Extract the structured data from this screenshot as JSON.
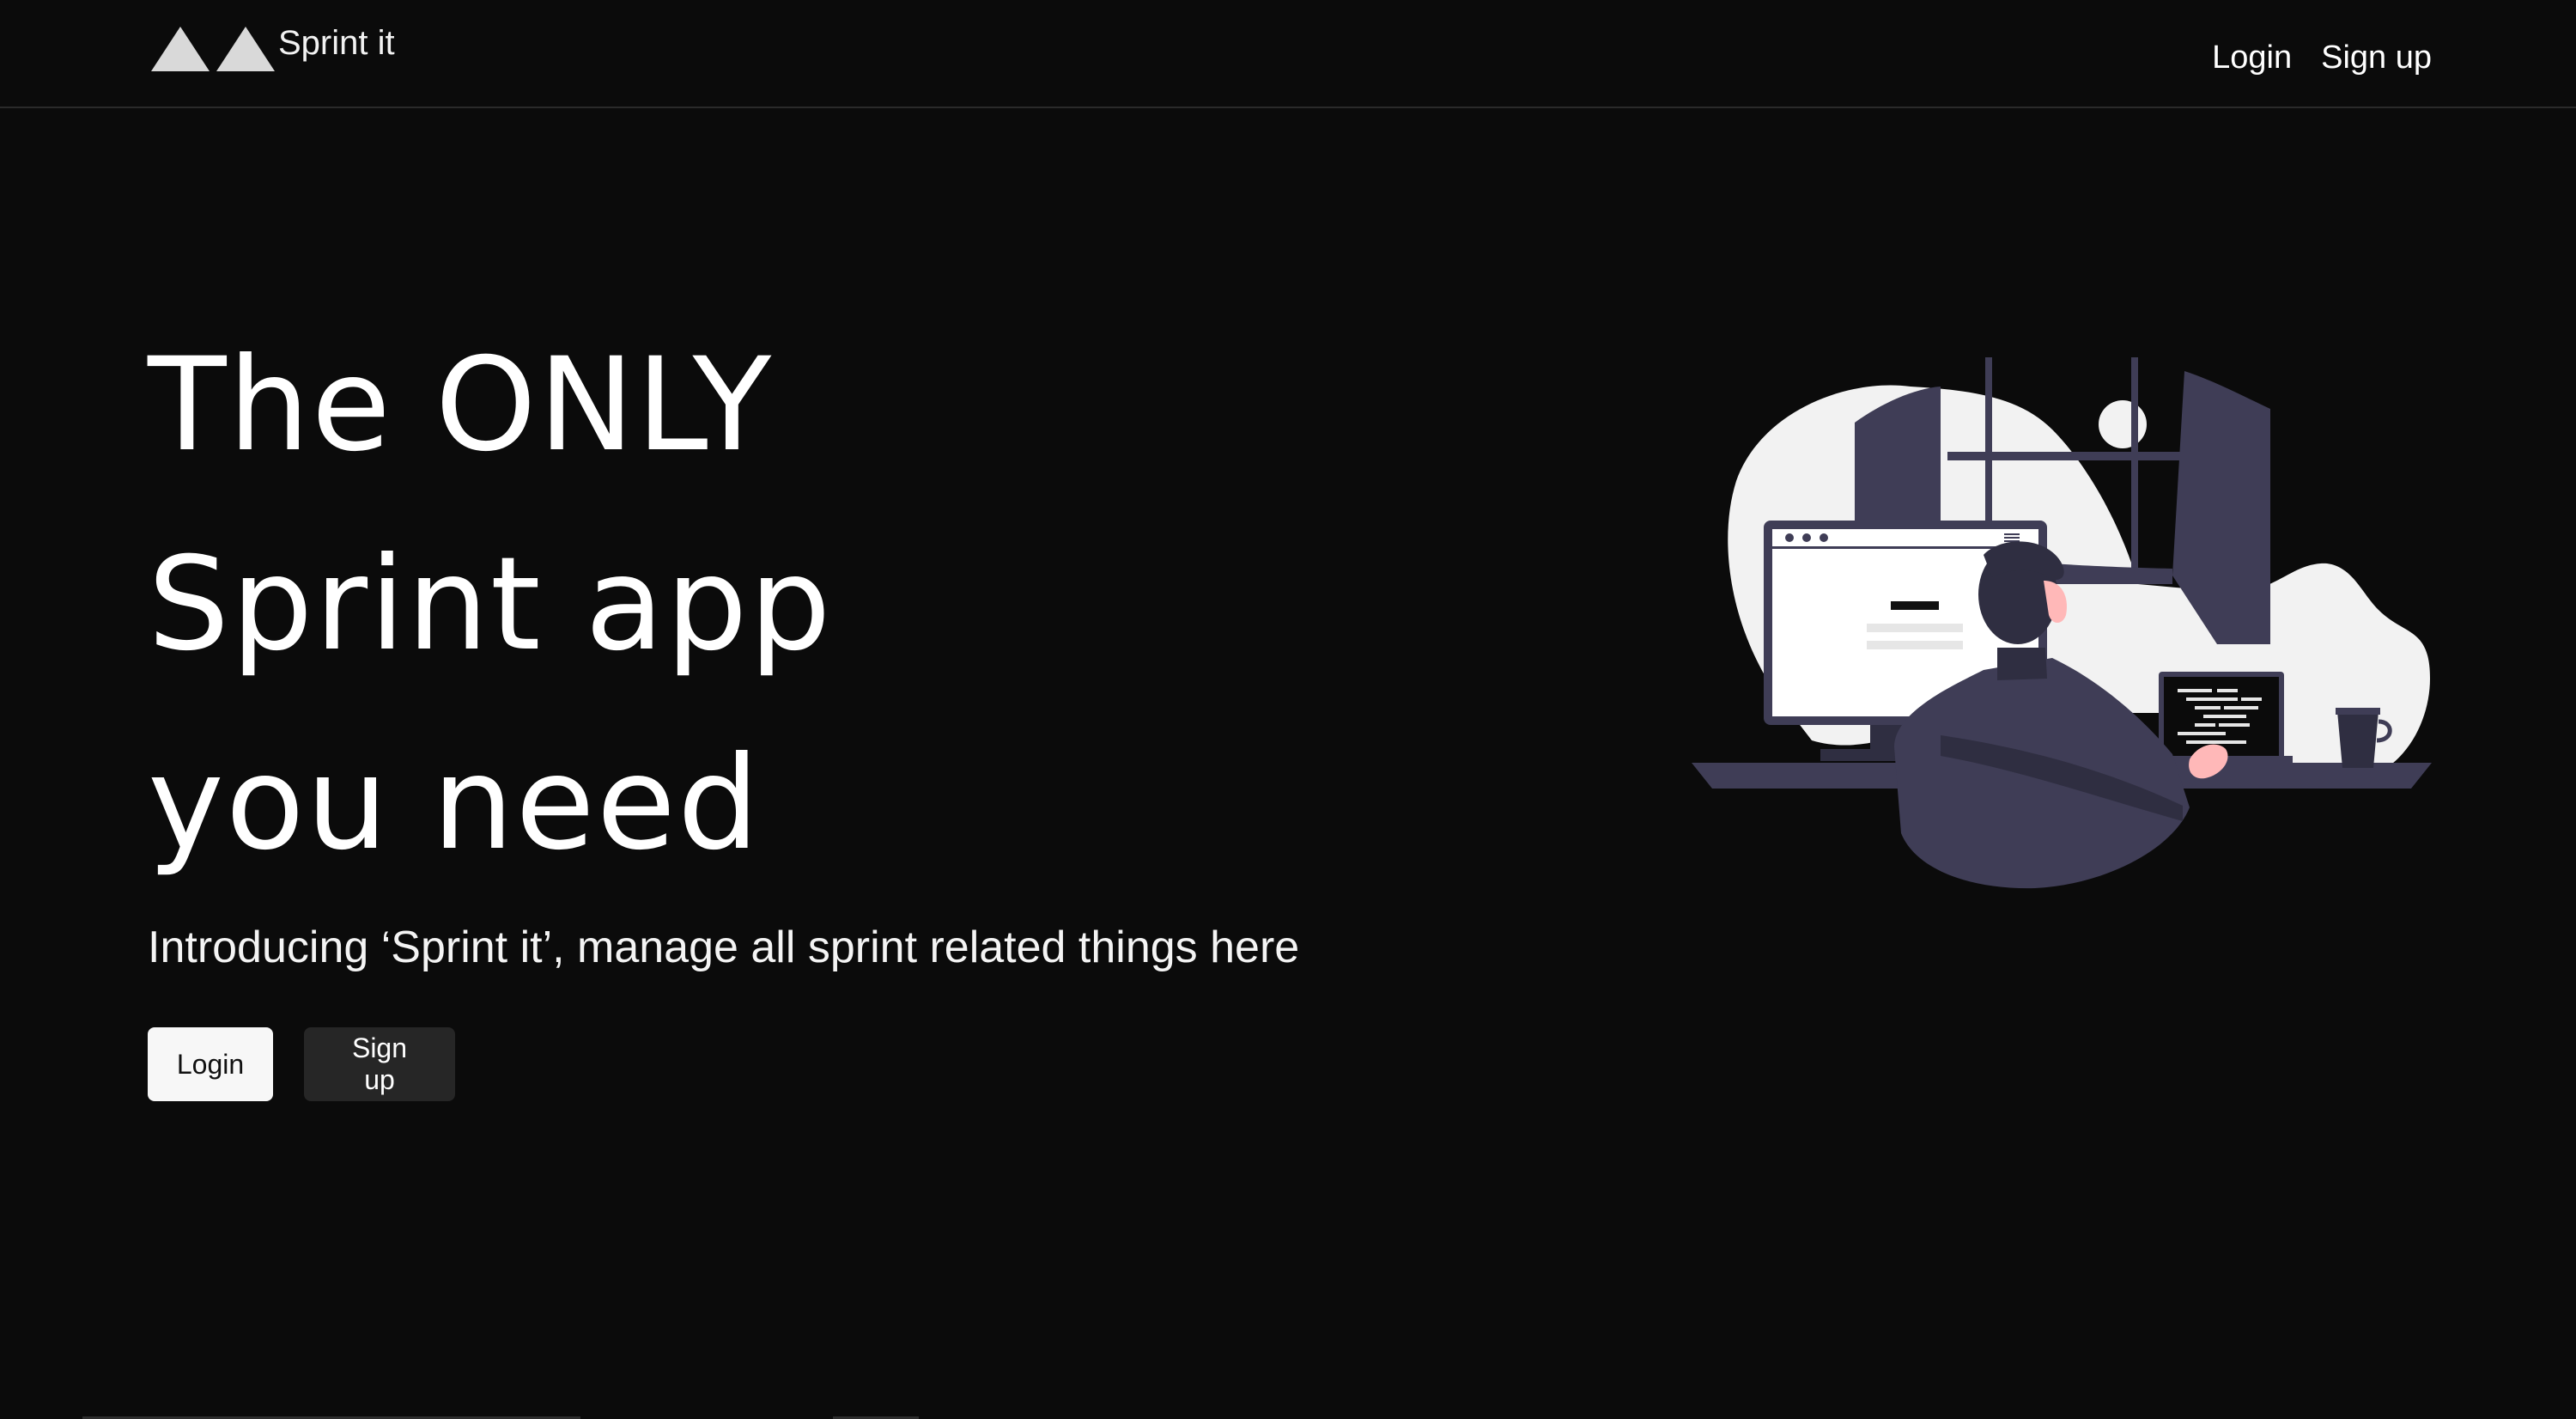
{
  "brand": {
    "name": "Sprint it",
    "logo_icon": "twin-triangles-logo"
  },
  "nav": {
    "login_label": "Login",
    "signup_label": "Sign up"
  },
  "hero": {
    "title_lines": [
      "The ONLY",
      "Sprint app",
      "you need"
    ],
    "subtitle": "Introducing ‘Sprint it’, manage all sprint related things here",
    "login_button": "Login",
    "signup_button": "Sign up",
    "illustration": "developer-at-desk-illustration"
  },
  "colors": {
    "background": "#0b0b0b",
    "text": "#ffffff",
    "primary_button_bg": "#f7f7f7",
    "secondary_button_bg": "#262626",
    "illustration_accent": "#3f3d56",
    "illustration_light": "#f2f2f2",
    "skin": "#ffb8b8"
  }
}
